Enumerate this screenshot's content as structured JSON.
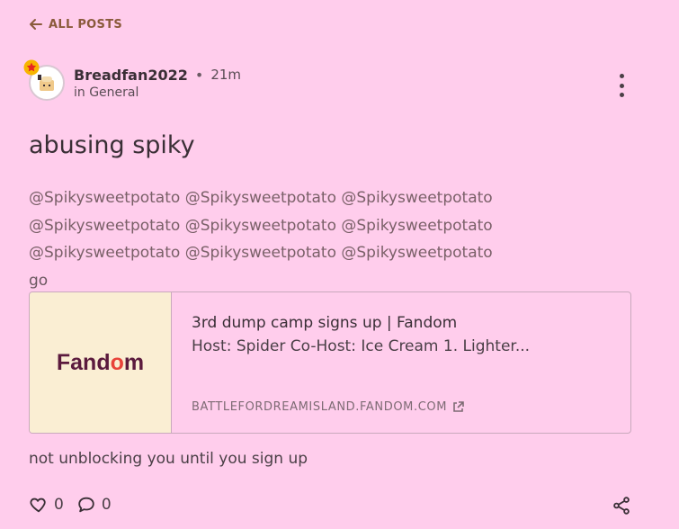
{
  "nav": {
    "back_label": "ALL POSTS"
  },
  "post": {
    "author": "Breadfan2022",
    "separator": "•",
    "time": "21m",
    "location": "in General",
    "title": "abusing spiky",
    "body_lines": [
      "@Spikysweetpotato @Spikysweetpotato @Spikysweetpotato",
      "@Spikysweetpotato @Spikysweetpotato @Spikysweetpotato",
      "@Spikysweetpotato @Spikysweetpotato @Spikysweetpotato",
      "go"
    ],
    "link_card": {
      "logo_text": "Fandom",
      "title": "3rd dump camp signs up | Fandom",
      "description": "Host: Spider Co-Host: Ice Cream 1. Lighter...",
      "domain": "BATTLEFORDREAMISLAND.FANDOM.COM"
    },
    "footer_text": "not unblocking you until you sign up",
    "likes": "0",
    "comments": "0"
  },
  "colors": {
    "background": "#ffcdec",
    "accent": "#8a5a3b",
    "logo": "#5b1a3d",
    "flame": "#e8433a"
  },
  "icons": [
    "arrow-left-icon",
    "star-badge-icon",
    "more-vertical-icon",
    "external-link-icon",
    "heart-icon",
    "comment-icon",
    "share-icon"
  ]
}
